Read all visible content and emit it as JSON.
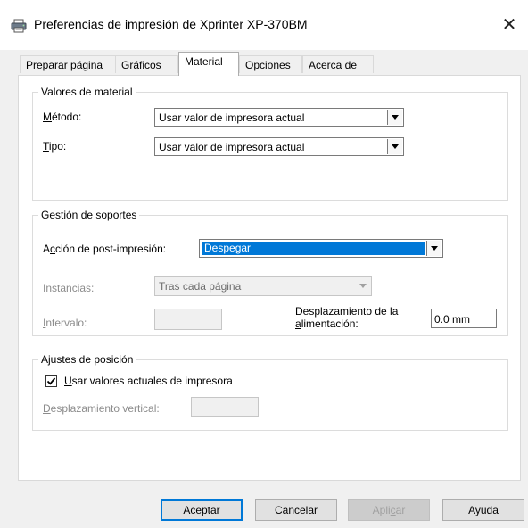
{
  "window": {
    "title": "Preferencias de impresión de Xprinter XP-370BM",
    "close_label": "✕"
  },
  "tabs": [
    {
      "label": "Preparar página",
      "active": false
    },
    {
      "label": "Gráficos",
      "active": false
    },
    {
      "label": "Material",
      "active": true
    },
    {
      "label": "Opciones",
      "active": false
    },
    {
      "label": "Acerca de",
      "active": false
    }
  ],
  "material_values": {
    "title": "Valores de material",
    "method_label_pre": "",
    "method_label_mnemonic": "M",
    "method_label_post": "étodo:",
    "method_value": "Usar valor de impresora actual",
    "type_label_mnemonic": "T",
    "type_label_post": "ipo:",
    "type_value": "Usar valor de impresora actual"
  },
  "media_handling": {
    "title": "Gestión de soportes",
    "post_action_label_pre": "A",
    "post_action_label_mnemonic": "c",
    "post_action_label_post": "ción de post-impresión:",
    "post_action_value": "Despegar",
    "instances_label_mnemonic": "I",
    "instances_label_post": "nstancias:",
    "instances_value": "Tras cada página",
    "interval_label_mnemonic": "I",
    "interval_label_post": "ntervalo:",
    "interval_value": "",
    "feed_offset_label_line1": "Desplazamiento de la",
    "feed_offset_label_line2_pre": "",
    "feed_offset_label_line2_mnemonic": "a",
    "feed_offset_label_line2_post": "limentación:",
    "feed_offset_value": "0.0 mm"
  },
  "position_settings": {
    "title": "Ajustes de posición",
    "use_current_label_mnemonic": "U",
    "use_current_label_post": "sar valores actuales de impresora",
    "use_current_checked": true,
    "vertical_offset_label_mnemonic": "D",
    "vertical_offset_label_post": "esplazamiento vertical:",
    "vertical_offset_value": ""
  },
  "buttons": {
    "ok": "Aceptar",
    "cancel": "Cancelar",
    "apply_pre": "Apli",
    "apply_mnemonic": "c",
    "apply_post": "ar",
    "help": "Ayuda"
  }
}
